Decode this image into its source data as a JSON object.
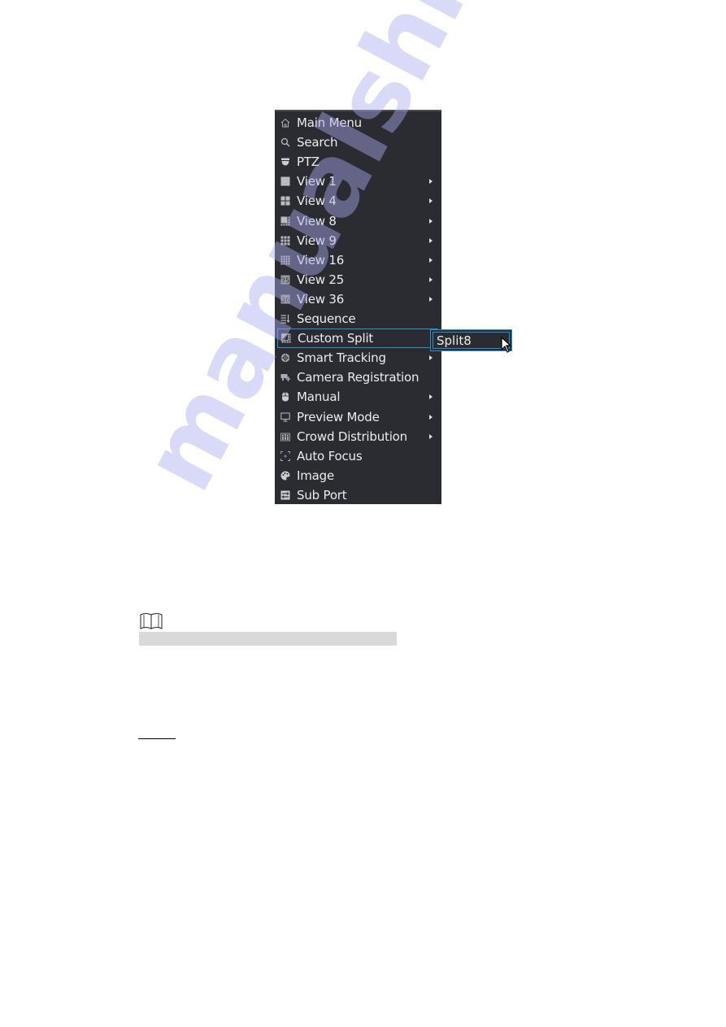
{
  "menu": {
    "items": [
      {
        "label": "Main Menu",
        "icon": "home-icon",
        "has_submenu": false
      },
      {
        "label": "Search",
        "icon": "search-icon",
        "has_submenu": false
      },
      {
        "label": "PTZ",
        "icon": "dome-camera-icon",
        "has_submenu": false
      },
      {
        "label": "View 1",
        "icon": "view1-icon",
        "has_submenu": true
      },
      {
        "label": "View 4",
        "icon": "view4-icon",
        "has_submenu": true
      },
      {
        "label": "View 8",
        "icon": "view8-icon",
        "has_submenu": true
      },
      {
        "label": "View 9",
        "icon": "view9-icon",
        "has_submenu": true
      },
      {
        "label": "View 16",
        "icon": "view16-icon",
        "has_submenu": true
      },
      {
        "label": "View 25",
        "icon": "view25-icon",
        "has_submenu": true
      },
      {
        "label": "View 36",
        "icon": "view36-icon",
        "has_submenu": true
      },
      {
        "label": "Sequence",
        "icon": "sequence-icon",
        "has_submenu": false
      },
      {
        "label": "Custom Split",
        "icon": "custom-split-icon",
        "has_submenu": false,
        "active": true
      },
      {
        "label": "Smart Tracking",
        "icon": "smart-tracking-icon",
        "has_submenu": true
      },
      {
        "label": "Camera Registration",
        "icon": "camera-registration-icon",
        "has_submenu": false
      },
      {
        "label": "Manual",
        "icon": "mouse-icon",
        "has_submenu": true
      },
      {
        "label": "Preview Mode",
        "icon": "monitor-icon",
        "has_submenu": true
      },
      {
        "label": "Crowd Distribution",
        "icon": "crowd-icon",
        "has_submenu": true
      },
      {
        "label": "Auto Focus",
        "icon": "focus-icon",
        "has_submenu": false
      },
      {
        "label": "Image",
        "icon": "palette-icon",
        "has_submenu": false
      },
      {
        "label": "Sub Port",
        "icon": "sub-port-icon",
        "has_submenu": false
      }
    ],
    "view25_badge": "25",
    "view36_badge": "36"
  },
  "submenu": {
    "items": [
      {
        "label": "Split8"
      }
    ]
  },
  "colors": {
    "menu_bg": "#2b2c31",
    "highlight": "#2a8fd0",
    "text": "#ececec"
  },
  "watermark": "manualshive"
}
